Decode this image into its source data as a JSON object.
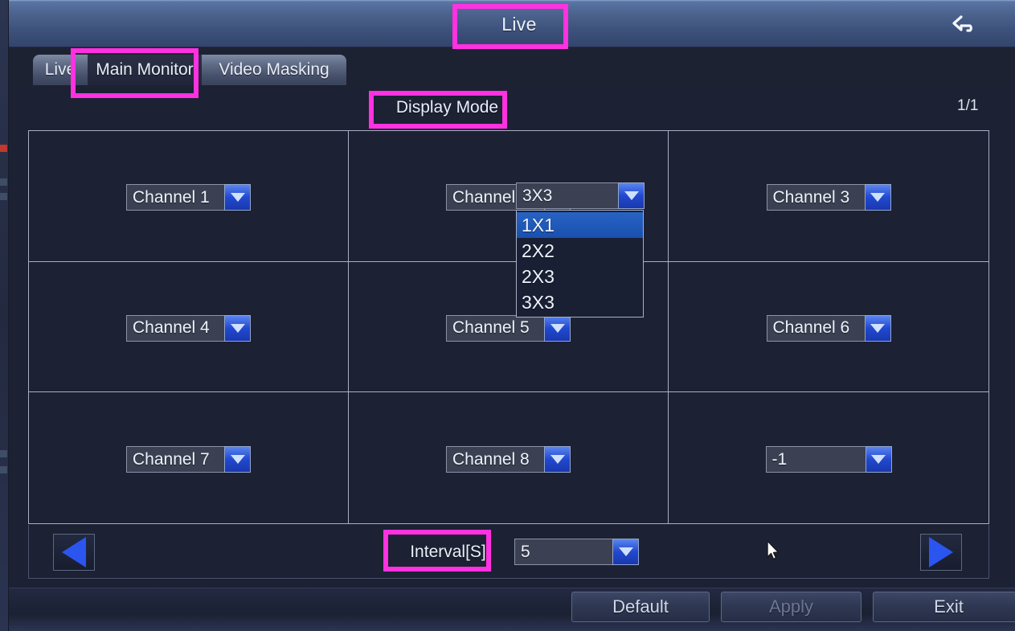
{
  "window": {
    "title": "Live",
    "back_icon": "back-arrow-icon"
  },
  "tabs": [
    {
      "label": "Live",
      "active": false
    },
    {
      "label": "Main Monitor",
      "active": true
    },
    {
      "label": "Video Masking",
      "active": false
    }
  ],
  "display_mode": {
    "label": "Display Mode",
    "value": "3X3",
    "options": [
      "1X1",
      "2X2",
      "2X3",
      "3X3"
    ],
    "highlighted_option": "1X1",
    "expanded": true
  },
  "page_indicator": "1/1",
  "grid": {
    "rows": 3,
    "columns": 3,
    "cells": [
      {
        "value": "Channel 1"
      },
      {
        "value": "Channel 2"
      },
      {
        "value": "Channel 3"
      },
      {
        "value": "Channel 4"
      },
      {
        "value": "Channel 5"
      },
      {
        "value": "Channel 6"
      },
      {
        "value": "Channel 7"
      },
      {
        "value": "Channel 8"
      },
      {
        "value": "-1"
      }
    ]
  },
  "navigation": {
    "prev_icon": "triangle-left-icon",
    "next_icon": "triangle-right-icon"
  },
  "interval": {
    "label": "Interval[S]",
    "value": "5"
  },
  "footer": {
    "default_label": "Default",
    "apply_label": "Apply",
    "exit_label": "Exit",
    "apply_disabled": true
  },
  "colors": {
    "titlebar_blue": "#4d658f",
    "panel_bg": "#1c2133",
    "accent_blue": "#2148cf",
    "annotation_magenta": "#ff31e0",
    "grid_line": "#a8aec4"
  }
}
